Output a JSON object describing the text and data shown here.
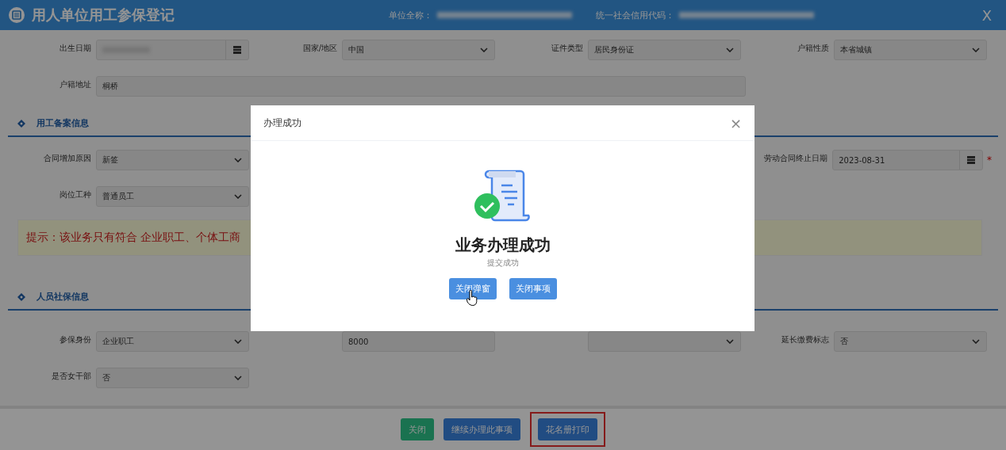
{
  "header": {
    "title": "用人单位用工参保登记",
    "fields": [
      {
        "label": "单位全称："
      },
      {
        "label": "统一社会信用代码："
      }
    ],
    "close": "X"
  },
  "top_rows": [
    [
      {
        "label": "出生日期",
        "kind": "date",
        "redacted": true
      },
      {
        "label": "国家/地区",
        "kind": "select",
        "value": "中国"
      },
      {
        "label": "证件类型",
        "kind": "select",
        "value": "居民身份证"
      },
      {
        "label": "户籍性质",
        "kind": "select",
        "value": "本省城镇"
      }
    ],
    [
      {
        "label": "户籍地址",
        "kind": "wide",
        "value": "桐桥"
      }
    ]
  ],
  "sections": [
    {
      "title": "用工备案信息",
      "rows": [
        [
          {
            "label": "合同增加原因",
            "kind": "select",
            "value": "新签"
          },
          {
            "label": "劳动合同终止日期",
            "kind": "date",
            "value": "2023-08-31",
            "marker": "*"
          }
        ],
        [
          {
            "label": "岗位工种",
            "kind": "select",
            "value": "普通员工"
          }
        ]
      ],
      "tip": "提示：该业务只有符合 企业职工、个体工商"
    },
    {
      "title": "人员社保信息",
      "rows": [
        [
          {
            "label": "参保身份",
            "kind": "select",
            "value": "企业职工"
          },
          {
            "kind": "text",
            "value": "8000"
          },
          {
            "kind": "select"
          },
          {
            "label": "延长缴费标志",
            "kind": "select",
            "value": "否"
          }
        ],
        [
          {
            "label": "是否女干部",
            "kind": "select",
            "value": "否"
          }
        ]
      ]
    }
  ],
  "footer": [
    {
      "label": "关闭",
      "kind": "success",
      "highlighted": false
    },
    {
      "label": "继续办理此事项",
      "kind": "primary",
      "highlighted": false
    },
    {
      "label": "花名册打印",
      "kind": "primary",
      "highlighted": true
    }
  ],
  "modal": {
    "title": "办理成功",
    "close": "×",
    "heading": "业务办理成功",
    "message": "提交成功",
    "buttons": [
      "关闭弹窗",
      "关闭事项"
    ]
  }
}
